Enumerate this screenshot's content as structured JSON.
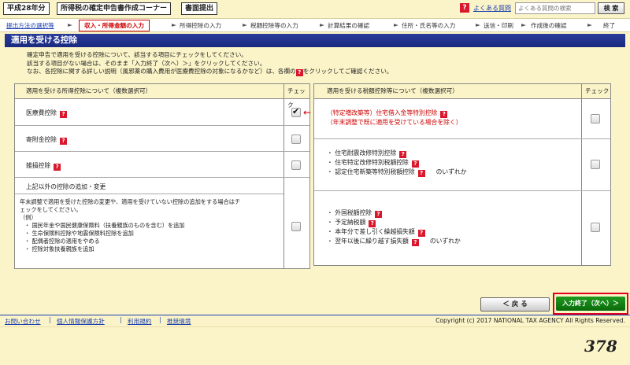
{
  "header": {
    "year_tab": "平成28年分",
    "corner_title": "所得税の確定申告書作成コーナー",
    "print_submit": "書面提出",
    "faq_label": "よくある質問",
    "search_placeholder": "よくある質問の検索",
    "search_button": "検 索",
    "help_icon_text": "?"
  },
  "steps": {
    "link_first": "提出方法の選択等",
    "current": "収入・所得金額の入力",
    "items": [
      "所得控除の入力",
      "税額控除等の入力",
      "計算結果の確認",
      "住所・氏名等の入力",
      "送信・印刷",
      "作成後の確認",
      "終了"
    ],
    "arrow": "►"
  },
  "page_title": "適用を受ける控除",
  "intro": {
    "line1": "確定申告で適用を受ける控除について、該当する項目にチェックをしてください。",
    "line2": "該当する項目がない場合は、そのまま「入力終了（次へ）＞」をクリックしてください。",
    "line3a": "なお、各控除に関する詳しい説明（風邪薬の購入費用が医療費控除の対象になるかなど）は、各欄の",
    "line3b": "をクリックしてご確認ください。"
  },
  "left_table": {
    "header": "適用を受ける所得控除について（複数選択可）",
    "check_header": "チェック",
    "rows": [
      {
        "label": "医療費控除",
        "checked": true
      },
      {
        "label": "寄附金控除",
        "checked": false
      },
      {
        "label": "雑損控除",
        "checked": false
      }
    ],
    "other": {
      "title": "上記以外の控除の追加・変更",
      "desc1": "年末調整で適用を受けた控除の変更や、適用を受けていない控除の追加をする場合はチ",
      "desc2": "ェックをしてください。",
      "example": "（例）",
      "bullets": [
        "・ 国民年金や国民健康保険料（扶養親族のものを含む）を追加",
        "・ 生命保険料控除や地震保険料控除を追加",
        "・ 配偶者控除の適用をやめる",
        "・ 控除対象扶養親族を追加"
      ],
      "checked": false
    }
  },
  "right_table": {
    "header": "適用を受ける税額控除等について（複数選択可）",
    "check_header": "チェック",
    "row1": {
      "line1": "（特定増改築等）住宅借入金等特別控除",
      "line2": "（年末調整で既に適用を受けている場合を除く）",
      "checked": false
    },
    "row2": {
      "bullets": [
        "・ 住宅耐震改修特別控除",
        "・ 住宅特定改修特別税額控除",
        "・ 認定住宅新築等特別税額控除"
      ],
      "suffix": "のいずれか",
      "checked": false
    },
    "row3": {
      "bullets": [
        "・ 外国税額控除",
        "・ 予定納税額",
        "・ 本年分で差し引く繰越損失額",
        "・ 翌年以後に繰り越す損失額"
      ],
      "suffix": "のいずれか",
      "checked": false
    }
  },
  "buttons": {
    "back": "＜ 戻 る",
    "next": "入力終了（次へ）＞"
  },
  "footer": {
    "links": [
      "お問い合わせ",
      "個人情報保護方針",
      "利用規約",
      "推奨環境"
    ],
    "copyright": "Copyright (c) 2017 NATIONAL TAX AGENCY All Rights Reserved."
  },
  "page_number": "378",
  "colors": {
    "background": "#fbf4c8",
    "title_bar": "#1a2a80",
    "help_red": "#d9182d",
    "next_button": "#0a6a0a",
    "highlight_border": "#e0001b"
  }
}
